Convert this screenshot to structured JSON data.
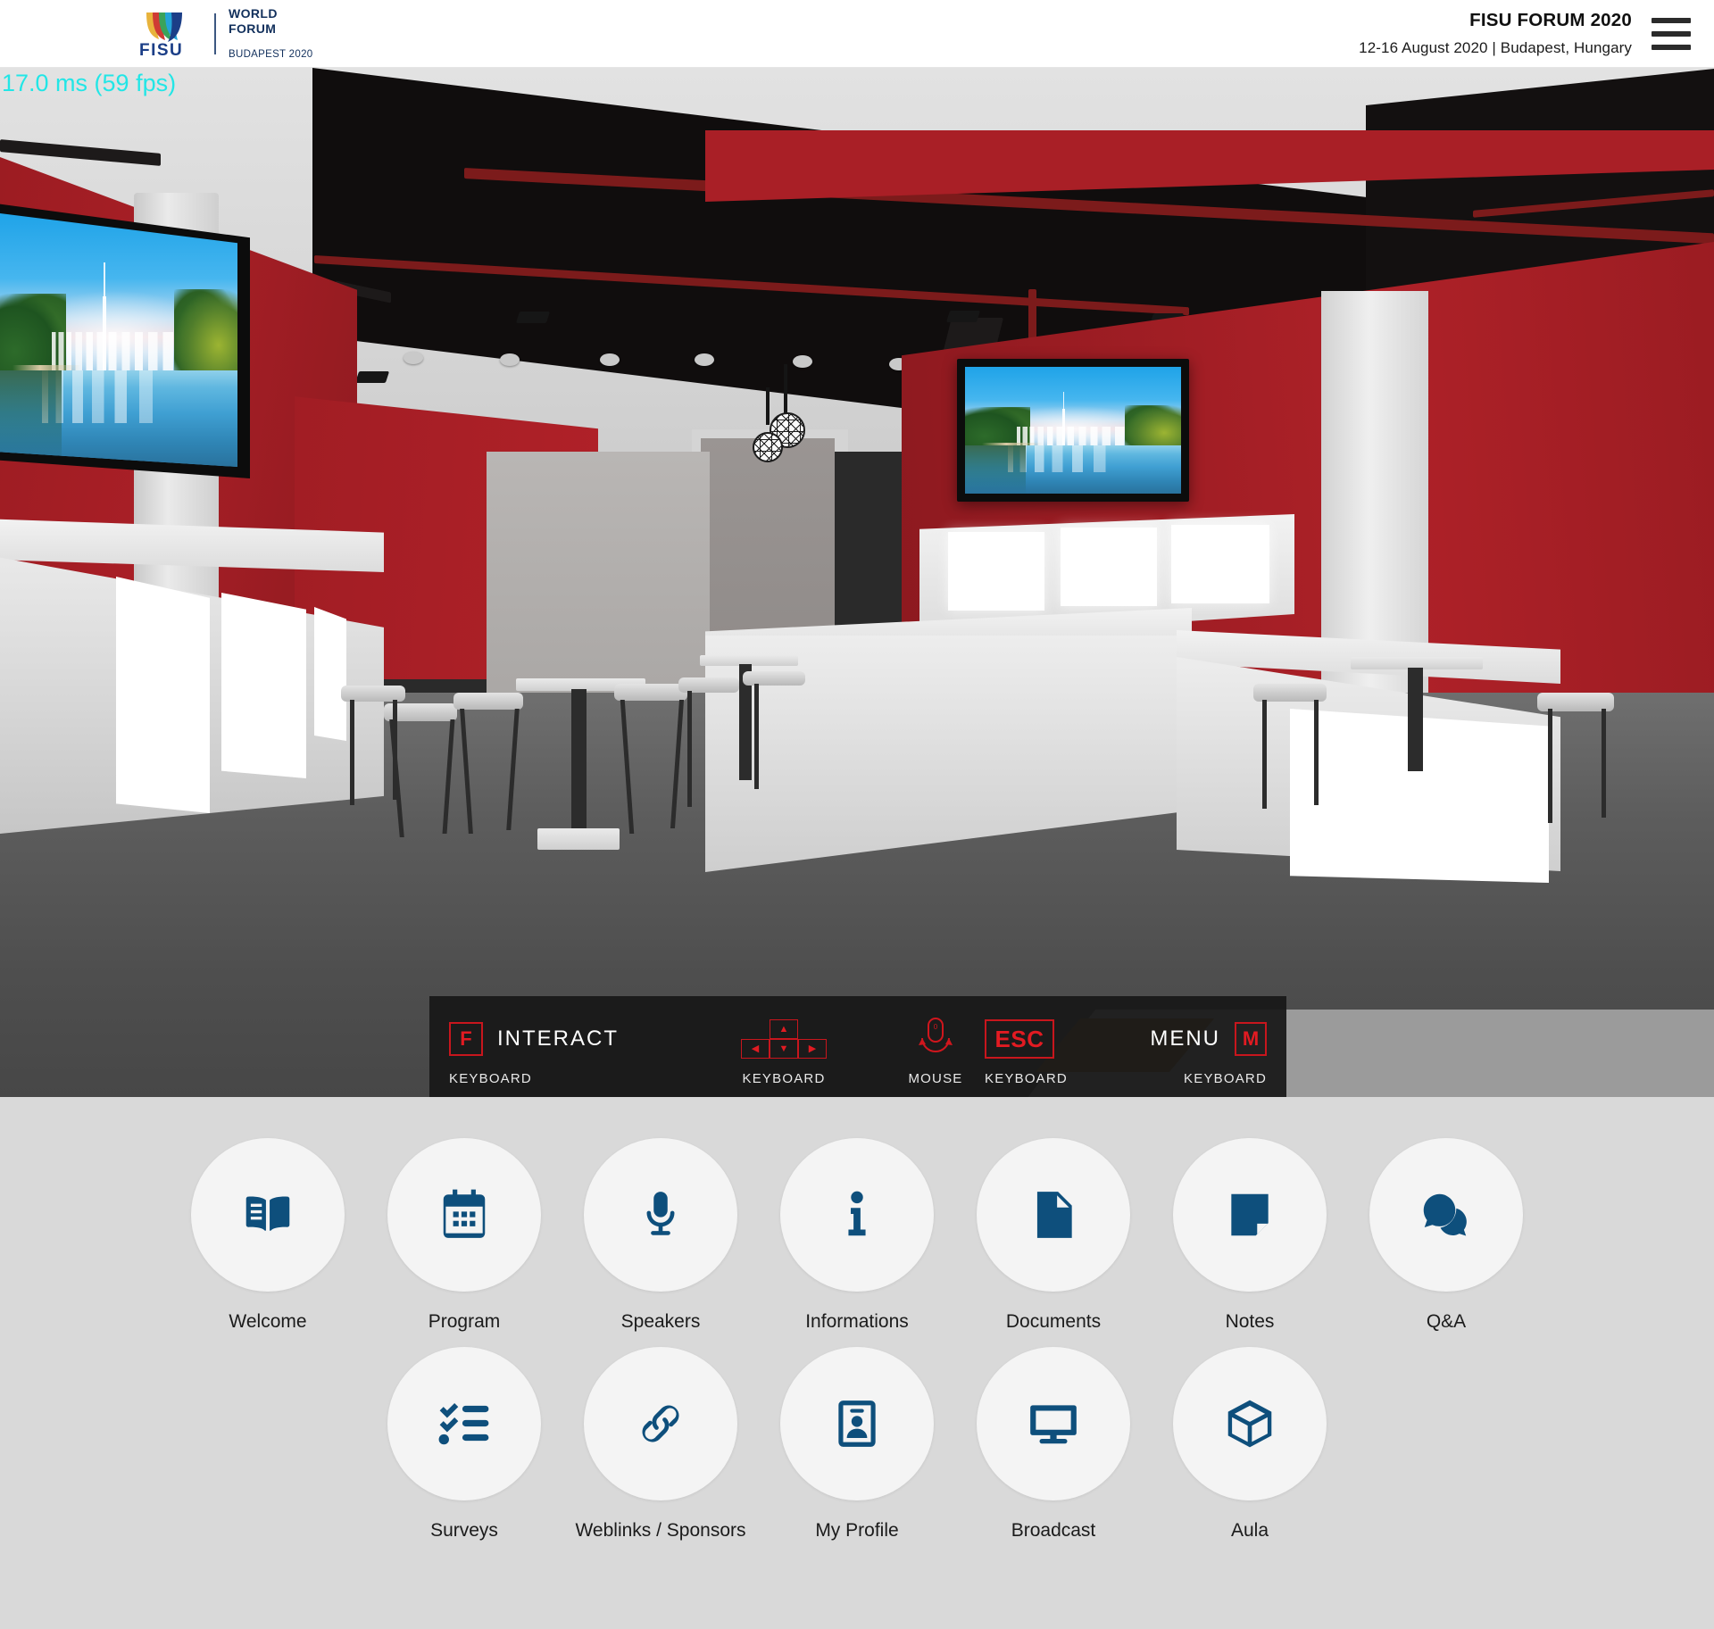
{
  "header": {
    "logo": {
      "brand": "FISU",
      "line1": "WORLD",
      "line2": "FORUM",
      "line3": "BUDAPEST 2020"
    },
    "title": "FISU FORUM 2020",
    "subtitle": "12-16 August 2020 | Budapest, Hungary",
    "menu_icon": "hamburger-menu-icon"
  },
  "viewport": {
    "fps_counter": "17.0 ms (59 fps)",
    "scene_name": "virtual-exhibition-hall"
  },
  "controls": [
    {
      "key": "F",
      "label": "INTERACT",
      "device": "KEYBOARD",
      "type": "key"
    },
    {
      "key": "",
      "label": "",
      "device": "KEYBOARD",
      "type": "arrows"
    },
    {
      "key": "",
      "label": "",
      "device": "MOUSE",
      "type": "mouse"
    },
    {
      "key": "ESC",
      "label": "",
      "device": "KEYBOARD",
      "type": "key"
    },
    {
      "key": "M",
      "label": "MENU",
      "device": "KEYBOARD",
      "type": "key"
    }
  ],
  "menu": {
    "row1": [
      {
        "label": "Welcome",
        "icon": "open-book-icon"
      },
      {
        "label": "Program",
        "icon": "calendar-icon"
      },
      {
        "label": "Speakers",
        "icon": "microphone-icon"
      },
      {
        "label": "Informations",
        "icon": "info-icon"
      },
      {
        "label": "Documents",
        "icon": "document-icon"
      },
      {
        "label": "Notes",
        "icon": "note-icon"
      },
      {
        "label": "Q&A",
        "icon": "chat-bubbles-icon"
      }
    ],
    "row2": [
      {
        "label": "Surveys",
        "icon": "checklist-icon"
      },
      {
        "label": "Weblinks / Sponsors",
        "icon": "chain-link-icon"
      },
      {
        "label": "My Profile",
        "icon": "id-badge-icon"
      },
      {
        "label": "Broadcast",
        "icon": "monitor-icon"
      },
      {
        "label": "Aula",
        "icon": "cube-icon"
      }
    ]
  },
  "colors": {
    "icon_blue": "#0e4f7c",
    "panel_bg": "#d9d9d9",
    "circle_bg": "#f4f4f4",
    "accent_red": "#e21b22",
    "fps_cyan": "#22e6e6",
    "wall_red": "#a91f26"
  }
}
